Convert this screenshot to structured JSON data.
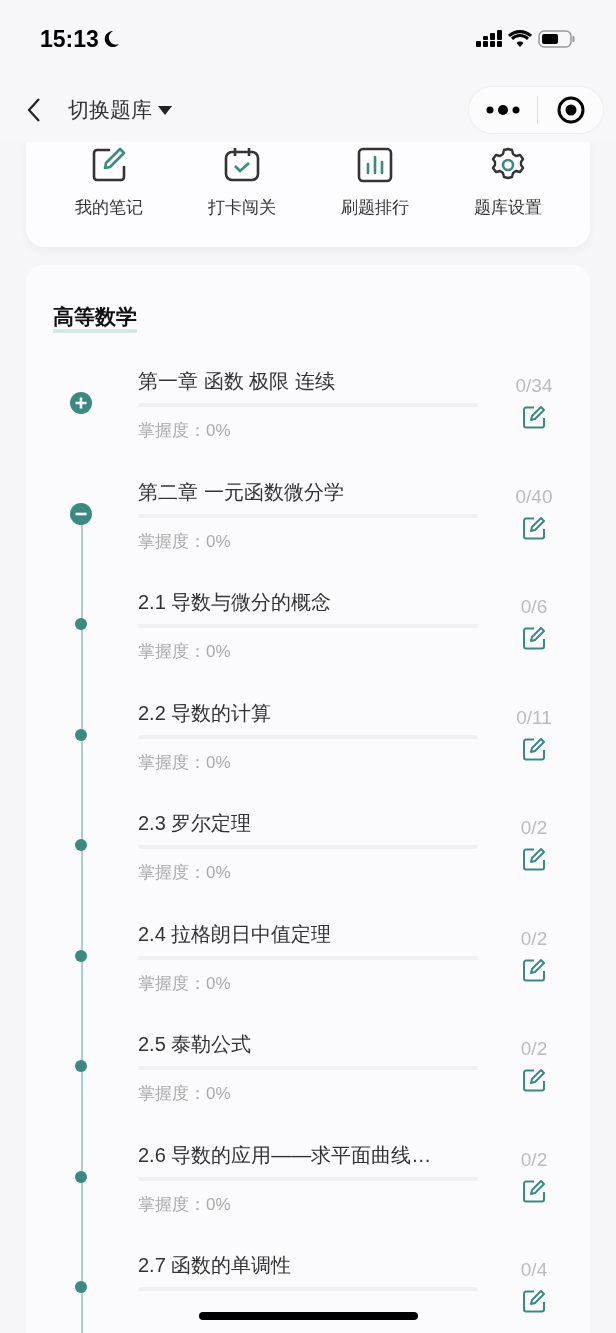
{
  "status_bar": {
    "time": "15:13"
  },
  "nav": {
    "title": "切换题库"
  },
  "tools": [
    {
      "label": "我的笔记",
      "kind": "note"
    },
    {
      "label": "打卡闯关",
      "kind": "checkin"
    },
    {
      "label": "刷题排行",
      "kind": "ranking"
    },
    {
      "label": "题库设置",
      "kind": "settings"
    }
  ],
  "section": {
    "title": "高等数学",
    "chapters": [
      {
        "title": "第一章 函数 极限 连续",
        "count": "0/34",
        "mastery": "掌握度：0%",
        "level": 0,
        "expanded": false
      },
      {
        "title": "第二章 一元函数微分学",
        "count": "0/40",
        "mastery": "掌握度：0%",
        "level": 0,
        "expanded": true,
        "children": [
          {
            "title": "2.1 导数与微分的概念",
            "count": "0/6",
            "mastery": "掌握度：0%",
            "level": 0
          },
          {
            "title": "2.2 导数的计算",
            "count": "0/11",
            "mastery": "掌握度：0%",
            "level": 0
          },
          {
            "title": "2.3 罗尔定理",
            "count": "0/2",
            "mastery": "掌握度：0%",
            "level": 0
          },
          {
            "title": "2.4 拉格朗日中值定理",
            "count": "0/2",
            "mastery": "掌握度：0%",
            "level": 0
          },
          {
            "title": "2.5 泰勒公式",
            "count": "0/2",
            "mastery": "掌握度：0%",
            "level": 0
          },
          {
            "title": "2.6 导数的应用——求平面曲线…",
            "count": "0/2",
            "mastery": "掌握度：0%",
            "level": 0
          },
          {
            "title": "2.7 函数的单调性",
            "count": "0/4",
            "level": 0
          }
        ]
      }
    ]
  }
}
